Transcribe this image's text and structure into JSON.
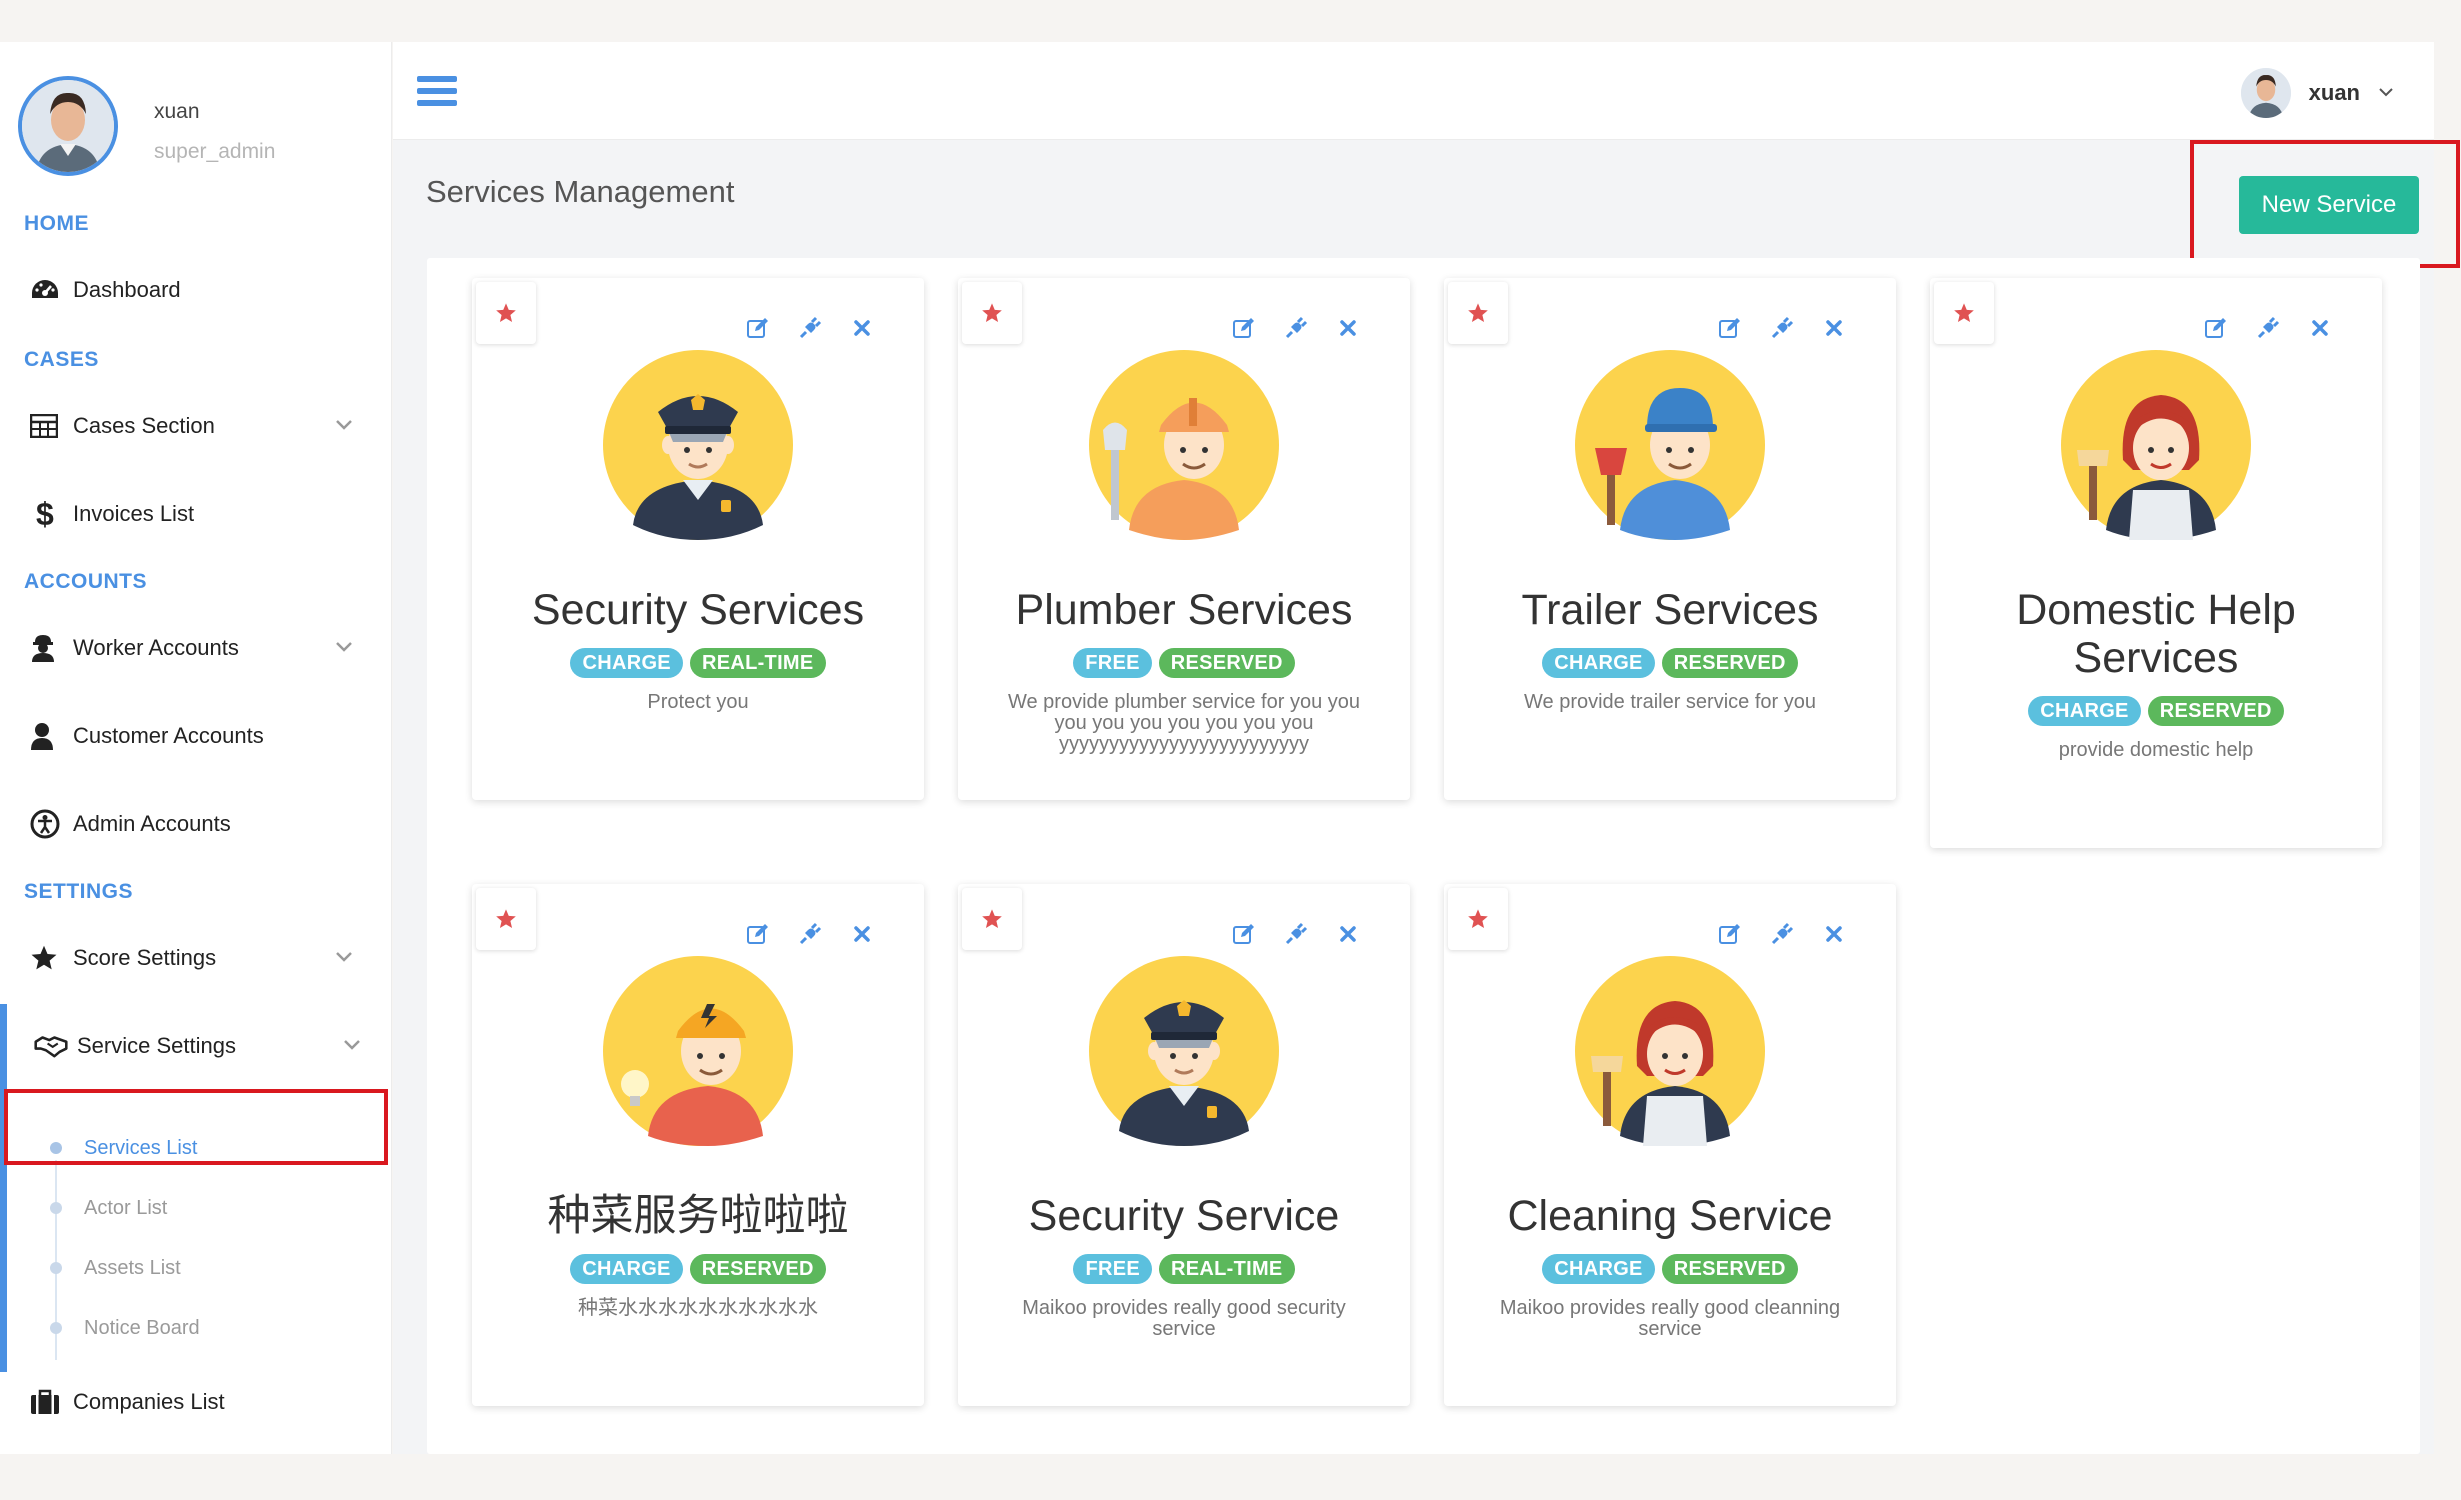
{
  "profile": {
    "name": "xuan",
    "role": "super_admin"
  },
  "nav": {
    "home": "HOME",
    "dashboard": "Dashboard",
    "cases": "CASES",
    "cases_section": "Cases Section",
    "invoices": "Invoices List",
    "accounts": "ACCOUNTS",
    "worker_accounts": "Worker Accounts",
    "customer_accounts": "Customer Accounts",
    "admin_accounts": "Admin Accounts",
    "settings": "SETTINGS",
    "score_settings": "Score Settings",
    "service_settings": "Service Settings",
    "services_list": "Services List",
    "actor_list": "Actor List",
    "assets_list": "Assets List",
    "notice_board": "Notice Board",
    "companies_list": "Companies List"
  },
  "topbar": {
    "user_name": "xuan"
  },
  "page": {
    "title": "Services Management",
    "new_service": "New Service"
  },
  "colors": {
    "accent": "#4a90e2",
    "success": "#26b99a",
    "badge_blue": "#5bc0de",
    "badge_green": "#5cb85c",
    "highlight": "#d9181f"
  },
  "cards": [
    {
      "title": "Security Services",
      "badge1": "CHARGE",
      "badge2": "REAL-TIME",
      "desc": "Protect you",
      "avatar": "security-guard"
    },
    {
      "title": "Plumber Services",
      "badge1": "FREE",
      "badge2": "RESERVED",
      "desc": "We provide plumber service for you you you you you you you you you yyyyyyyyyyyyyyyyyyyyyyyyy",
      "avatar": "plumber"
    },
    {
      "title": "Trailer Services",
      "badge1": "CHARGE",
      "badge2": "RESERVED",
      "desc": "We provide trailer service for you",
      "avatar": "plumber-blue"
    },
    {
      "title": "Domestic Help Services",
      "badge1": "CHARGE",
      "badge2": "RESERVED",
      "desc": "provide domestic help",
      "avatar": "maid"
    },
    {
      "title": "种菜服务啦啦啦",
      "badge1": "CHARGE",
      "badge2": "RESERVED",
      "desc": "种菜水水水水水水水水水水",
      "avatar": "electrician"
    },
    {
      "title": "Security Service",
      "badge1": "FREE",
      "badge2": "REAL-TIME",
      "desc": "Maikoo provides really good security service",
      "avatar": "security-guard"
    },
    {
      "title": "Cleaning Service",
      "badge1": "CHARGE",
      "badge2": "RESERVED",
      "desc": "Maikoo provides really good cleanning service",
      "avatar": "maid"
    }
  ]
}
